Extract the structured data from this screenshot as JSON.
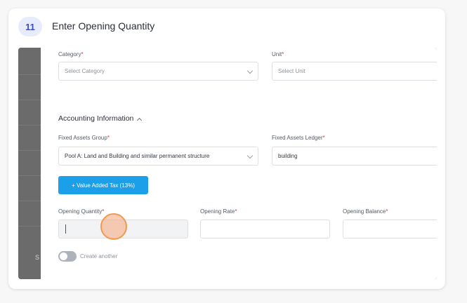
{
  "step": {
    "number": "11",
    "title": "Enter Opening Quantity"
  },
  "background": {
    "side_letter": "S"
  },
  "form": {
    "category": {
      "label": "Category",
      "placeholder": "Select Category"
    },
    "unit": {
      "label": "Unit",
      "placeholder": "Select Unit"
    },
    "accounting_section": "Accounting Information",
    "fixed_assets_group": {
      "label": "Fixed Assets Group",
      "value": "Pool A: Land and Building and similar permanent structure"
    },
    "fixed_assets_ledger": {
      "label": "Fixed Assets Ledger",
      "value": "building"
    },
    "vat_button": "+ Value Added Tax (13%)",
    "opening_quantity": {
      "label": "Opening Quantity",
      "value": ""
    },
    "opening_rate": {
      "label": "Opening Rate",
      "value": ""
    },
    "opening_balance": {
      "label": "Opening Balance",
      "value": ""
    },
    "create_another": {
      "label": "Create another",
      "enabled": false
    },
    "required_marker": "*"
  },
  "colors": {
    "accent": "#1a9fe8",
    "required": "#e0303a",
    "badge_bg": "#e8ebfb",
    "click_highlight": "#f1994f"
  }
}
